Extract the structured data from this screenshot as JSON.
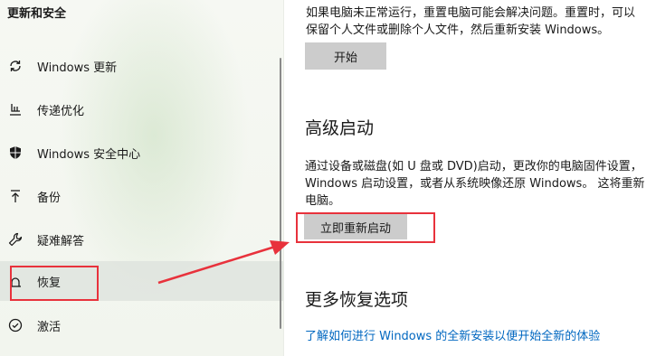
{
  "sidebar": {
    "title": "更新和安全",
    "items": [
      {
        "label": "Windows 更新",
        "icon": "sync-icon"
      },
      {
        "label": "传递优化",
        "icon": "delivery-optimization-icon"
      },
      {
        "label": "Windows 安全中心",
        "icon": "shield-icon"
      },
      {
        "label": "备份",
        "icon": "backup-arrow-icon"
      },
      {
        "label": "疑难解答",
        "icon": "wrench-icon"
      },
      {
        "label": "恢复",
        "icon": "recovery-icon",
        "selected": true
      },
      {
        "label": "激活",
        "icon": "check-circle-icon"
      }
    ]
  },
  "reset": {
    "line1": "如果电脑未正常运行，重置电脑可能会解决问题。重置时，可以",
    "line2": "保留个人文件或删除个人文件，然后重新安装 Windows。",
    "button": "开始"
  },
  "advanced_startup": {
    "heading": "高级启动",
    "line1": "通过设备或磁盘(如 U 盘或 DVD)启动，更改你的电脑固件设置，",
    "line2": "Windows 启动设置，或者从系统映像还原 Windows。 这将重新",
    "line3": "电脑。",
    "button": "立即重新启动"
  },
  "more_recovery": {
    "heading": "更多恢复选项",
    "link": "了解如何进行 Windows 的全新安装以便开始全新的体验"
  },
  "colors": {
    "link": "#0067c0",
    "annotation": "#e8323c",
    "button_bg": "#cccccc"
  }
}
